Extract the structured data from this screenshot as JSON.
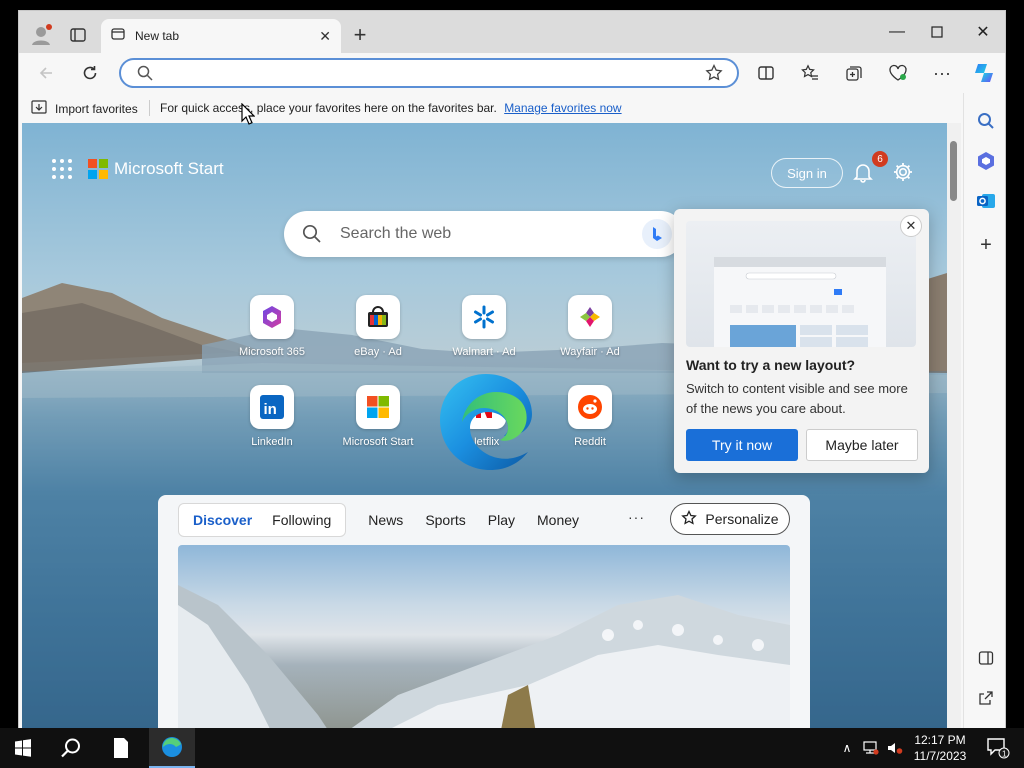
{
  "tab": {
    "title": "New tab"
  },
  "address_bar": {
    "value": "",
    "placeholder": ""
  },
  "favorites_bar": {
    "import_label": "Import favorites",
    "hint_text": "For quick access, place your favorites here on the favorites bar.",
    "manage_link": "Manage favorites now"
  },
  "header": {
    "brand": "Microsoft Start",
    "sign_in": "Sign in",
    "notification_count": "6"
  },
  "web_search": {
    "placeholder": "Search the web"
  },
  "quick_links": [
    {
      "label": "Microsoft 365",
      "icon": "microsoft-365-icon"
    },
    {
      "label": "eBay · Ad",
      "icon": "ebay-icon"
    },
    {
      "label": "Walmart · Ad",
      "icon": "walmart-icon"
    },
    {
      "label": "Wayfair · Ad",
      "icon": "wayfair-icon"
    },
    {
      "label": "LinkedIn",
      "icon": "linkedin-icon"
    },
    {
      "label": "Microsoft Start",
      "icon": "microsoft-start-icon"
    },
    {
      "label": "Netflix",
      "icon": "netflix-icon"
    },
    {
      "label": "Reddit",
      "icon": "reddit-icon"
    }
  ],
  "popup": {
    "title": "Want to try a new layout?",
    "description": "Switch to content visible and see more of the news you care about.",
    "try_button": "Try it now",
    "later_button": "Maybe later"
  },
  "feed": {
    "segments": [
      "Discover",
      "Following"
    ],
    "active_segment": "Discover",
    "categories": [
      "News",
      "Sports",
      "Play",
      "Money"
    ],
    "more": "···",
    "personalize": "Personalize"
  },
  "taskbar": {
    "time": "12:17 PM",
    "date": "11/7/2023",
    "notifications": "1"
  },
  "colors": {
    "accent": "#1a6fd8",
    "badge": "#d13b1f"
  }
}
